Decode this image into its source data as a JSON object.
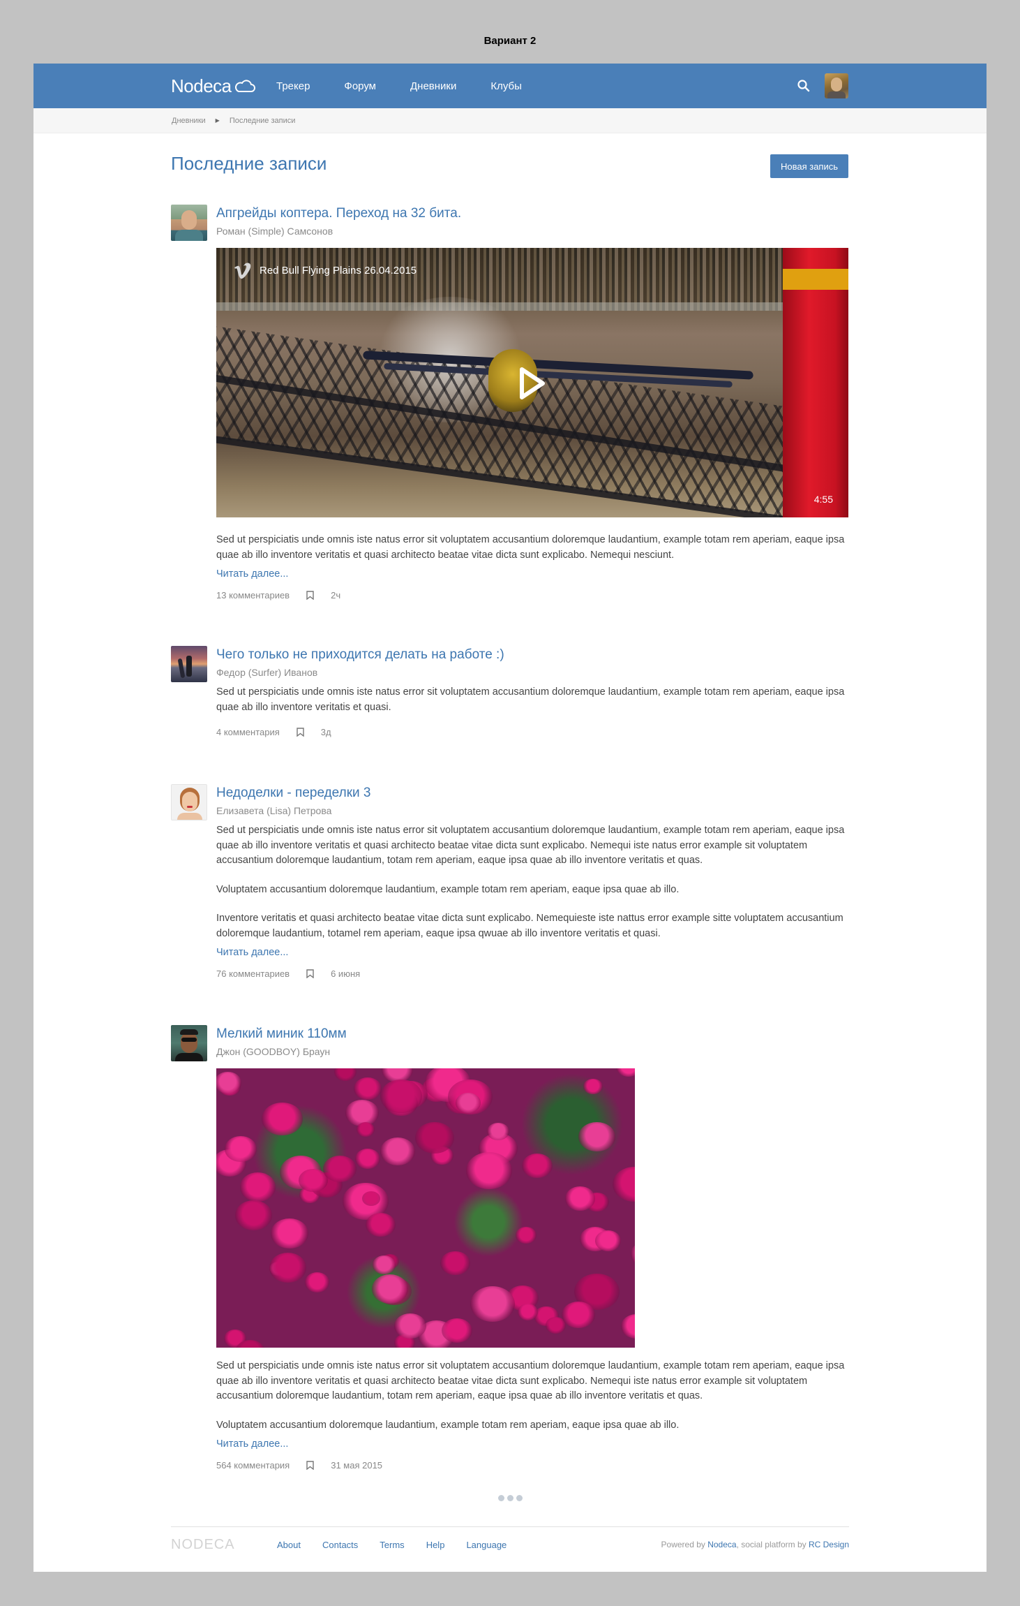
{
  "variant_label": "Вариант 2",
  "header": {
    "logo": "Nodeca",
    "nav": [
      "Трекер",
      "Форум",
      "Дневники",
      "Клубы"
    ]
  },
  "breadcrumb": [
    "Дневники",
    "Последние записи"
  ],
  "page": {
    "title": "Последние записи",
    "new_post_button": "Новая запись"
  },
  "posts": [
    {
      "title": "Апгрейды коптера. Переход на 32 бита.",
      "author": "Роман (Simple) Самсонов",
      "video": {
        "title": "Red Bull Flying Plains 26.04.2015",
        "duration": "4:55"
      },
      "paragraphs": [
        "Sed ut perspiciatis unde omnis iste natus error sit voluptatem accusantium doloremque laudantium, example totam rem aperiam, eaque ipsa quae ab illo inventore veritatis et quasi architecto beatae vitae dicta sunt explicabo. Nemequi nesciunt."
      ],
      "read_more": "Читать далее...",
      "comments": "13 комментариев",
      "time": "2ч"
    },
    {
      "title": "Чего только не приходится делать на работе :)",
      "author": "Федор (Surfer) Иванов",
      "paragraphs": [
        "Sed ut perspiciatis unde omnis iste natus error sit voluptatem accusantium doloremque laudantium, example totam rem aperiam, eaque ipsa quae ab illo inventore veritatis et quasi."
      ],
      "comments": "4 комментария",
      "time": "3д"
    },
    {
      "title": "Недоделки - переделки 3",
      "author": "Елизавета (Lisa) Петрова",
      "paragraphs": [
        "Sed ut perspiciatis unde omnis iste natus error sit voluptatem accusantium doloremque laudantium, example totam rem aperiam, eaque ipsa quae ab illo inventore veritatis et quasi architecto beatae vitae dicta sunt explicabo. Nemequi iste natus error example sit voluptatem accusantium doloremque laudantium,  totam rem aperiam, eaque ipsa quae ab illo inventore veritatis et quas.",
        "Voluptatem accusantium doloremque laudantium, example totam rem aperiam, eaque ipsa quae ab illo.",
        "Inventore veritatis et quasi architecto beatae vitae dicta sunt explicabo. Nemequieste iste nattus error example sitte voluptatem accusantium doloremque laudantium,  totamel rem aperiam, eaque ipsa qwuae ab illo inventore veritatis et quasi."
      ],
      "read_more": "Читать далее...",
      "comments": "76 комментариев",
      "time": "6 июня"
    },
    {
      "title": "Мелкий миник 110мм",
      "author": "Джон (GOODBOY) Браун",
      "paragraphs": [
        "Sed ut perspiciatis unde omnis iste natus error sit voluptatem accusantium doloremque laudantium, example totam rem aperiam, eaque ipsa quae ab illo inventore veritatis et quasi architecto beatae vitae dicta sunt explicabo. Nemequi iste natus error example sit voluptatem accusantium doloremque laudantium,  totam rem aperiam, eaque ipsa quae ab illo inventore veritatis et quas.",
        "Voluptatem accusantium doloremque laudantium, example totam rem aperiam, eaque ipsa quae ab illo."
      ],
      "read_more": "Читать далее...",
      "comments": "564 комментария",
      "time": "31 мая 2015"
    }
  ],
  "footer": {
    "logo": "NODECA",
    "links": [
      "About",
      "Contacts",
      "Terms",
      "Help",
      "Language"
    ],
    "powered_prefix": "Powered by ",
    "powered_brand": "Nodeca",
    "powered_middle": ", social platform by ",
    "powered_company": "RC Design"
  },
  "colors": {
    "brand": "#4a7fb8",
    "link": "#3d76b0",
    "background": "#c2c2c2"
  }
}
